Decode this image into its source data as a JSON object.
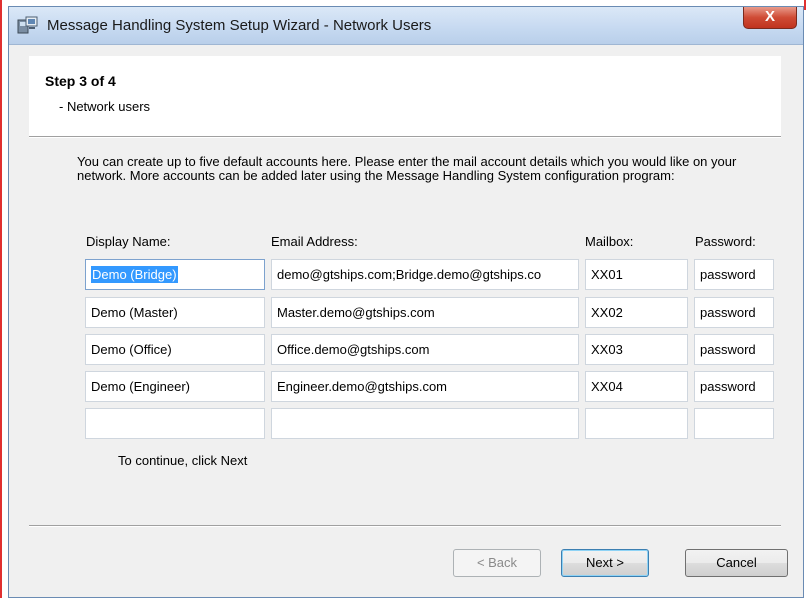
{
  "window": {
    "title": "Message Handling System Setup Wizard - Network Users",
    "close_label": "X"
  },
  "header": {
    "step": "Step 3 of 4",
    "subtitle": "- Network users"
  },
  "intro_text": "You can create up to five default accounts here. Please enter the mail account details which you would like on your network.  More accounts can be added later using the Message Handling System configuration program:",
  "columns": {
    "display_name": "Display Name:",
    "email": "Email Address:",
    "mailbox": "Mailbox:",
    "password": "Password:"
  },
  "rows": [
    {
      "display_name": "Demo (Bridge)",
      "email": "demo@gtships.com;Bridge.demo@gtships.co",
      "mailbox": "XX01",
      "password": "password"
    },
    {
      "display_name": "Demo (Master)",
      "email": "Master.demo@gtships.com",
      "mailbox": "XX02",
      "password": "password"
    },
    {
      "display_name": "Demo (Office)",
      "email": "Office.demo@gtships.com",
      "mailbox": "XX03",
      "password": "password"
    },
    {
      "display_name": "Demo (Engineer)",
      "email": "Engineer.demo@gtships.com",
      "mailbox": "XX04",
      "password": "password"
    },
    {
      "display_name": "",
      "email": "",
      "mailbox": "",
      "password": ""
    }
  ],
  "continue_text": "To continue, click Next",
  "buttons": {
    "back": "< Back",
    "next": "Next >",
    "cancel": "Cancel"
  },
  "icons": {
    "app": "setup-wizard-icon",
    "close": "close-icon"
  },
  "colors": {
    "selection": "#3399ff",
    "close_button": "#c0331f",
    "titlebar": "#c7daf1"
  }
}
